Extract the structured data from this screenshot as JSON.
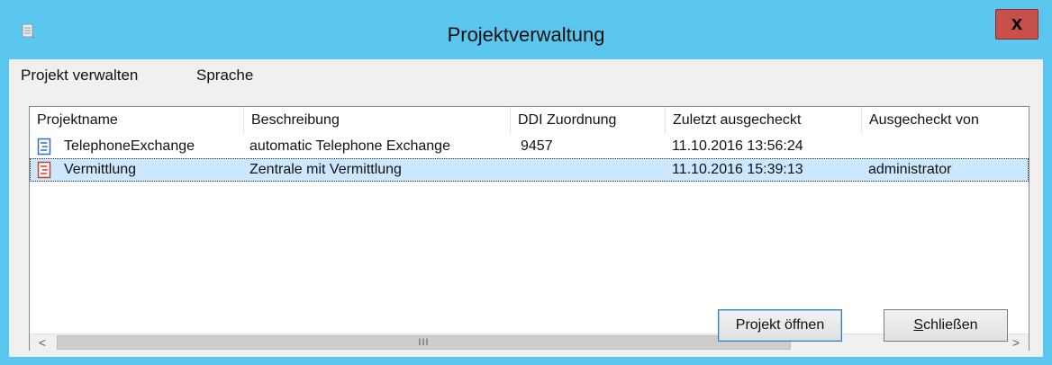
{
  "window": {
    "title": "Projektverwaltung",
    "close_label": "x"
  },
  "menu": {
    "items": [
      "Projekt verwalten",
      "Sprache"
    ]
  },
  "list": {
    "columns": [
      "Projektname",
      "Beschreibung",
      "DDI Zuordnung",
      "Zuletzt ausgecheckt",
      "Ausgecheckt von"
    ],
    "rows": [
      {
        "name": "TelephoneExchange",
        "description": "automatic Telephone Exchange",
        "ddi": "9457",
        "last_checkout": "11.10.2016 13:56:24",
        "checked_out_by": "",
        "icon": "document-icon",
        "selected": false
      },
      {
        "name": "Vermittlung",
        "description": "Zentrale mit Vermittlung",
        "ddi": "",
        "last_checkout": "11.10.2016 15:39:13",
        "checked_out_by": "administrator",
        "icon": "checked-out-document-icon",
        "selected": true
      }
    ]
  },
  "scrollbar": {
    "left_arrow": "<",
    "right_arrow": ">",
    "grip": "III"
  },
  "buttons": {
    "open": "Projekt öffnen",
    "close": "Schließen"
  },
  "colors": {
    "titlebar": "#5bc7ee",
    "close_button": "#c7504b",
    "selection": "#cce8ff",
    "doc_icon_blue": "#2a6fc9",
    "doc_icon_red": "#d23a2a"
  }
}
